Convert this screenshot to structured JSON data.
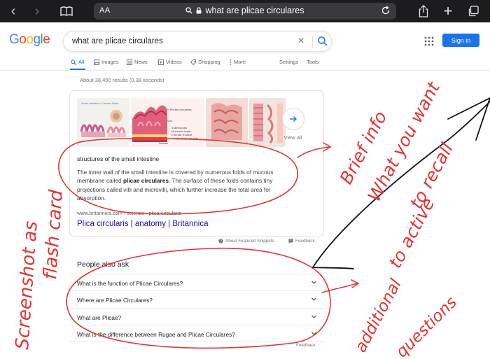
{
  "browser": {
    "text_size_label": "AA",
    "url": "what are plicae circulares"
  },
  "google": {
    "logo_letters": [
      {
        "ch": "G",
        "color": "#4285f4"
      },
      {
        "ch": "o",
        "color": "#ea4335"
      },
      {
        "ch": "o",
        "color": "#fbbc05"
      },
      {
        "ch": "g",
        "color": "#4285f4"
      },
      {
        "ch": "l",
        "color": "#34a853"
      },
      {
        "ch": "e",
        "color": "#ea4335"
      }
    ],
    "search_query": "what are plicae circulares",
    "sign_in_label": "Sign in",
    "accent_color": "#1a73e8"
  },
  "nav": {
    "all": "All",
    "images": "Images",
    "news": "News",
    "videos": "Videos",
    "shopping": "Shopping",
    "more": "More",
    "settings": "Settings",
    "tools": "Tools"
  },
  "result_stats": "About 38,400 results (0.38 seconds)",
  "snippet": {
    "view_all": "View all",
    "image_labels": {
      "img2_label": "Plicae circulares",
      "img2_villi": "Villi",
      "img2_sub": "Submucosa",
      "img2_musc": "Muscular layer",
      "img2_circ": "Circular muscle",
      "img2_long": "Longitudinal muscle",
      "img2_serosa": "Serosa",
      "img1_title": "Small intestine: Circular Folds"
    },
    "heading": "structures of the small intestine",
    "text_before": "The inner wall of the small intestine is covered by numerous folds of mucous membrane called ",
    "text_bold": "plicae circulares",
    "text_after": ". The surface of these folds contains tiny projections called villi and microvilli, which further increase the total area for absorption.",
    "cite": "www.britannica.com › science › plica-circularis",
    "link_title": "Plica circularis | anatomy | Britannica"
  },
  "about_snippets": "About Featured Snippets",
  "feedback": "Feedback",
  "people_also_ask": {
    "title": "People also ask",
    "questions": [
      "What is the function of Plicae Circulares?",
      "Where are Plicae Circulares?",
      "What are Plicae?",
      "What is the difference between Rugae and Plicae Circulares?"
    ]
  },
  "annotations": {
    "color": "#e03535",
    "left_text_1": "Screenshot as",
    "left_text_2": "flash card",
    "right_text_1": "Brief info",
    "right_text_2": "What you want",
    "right_text_3": "to recall",
    "right_text_4": "to active",
    "bottom_text_1": "additional",
    "bottom_text_2": "questions"
  }
}
